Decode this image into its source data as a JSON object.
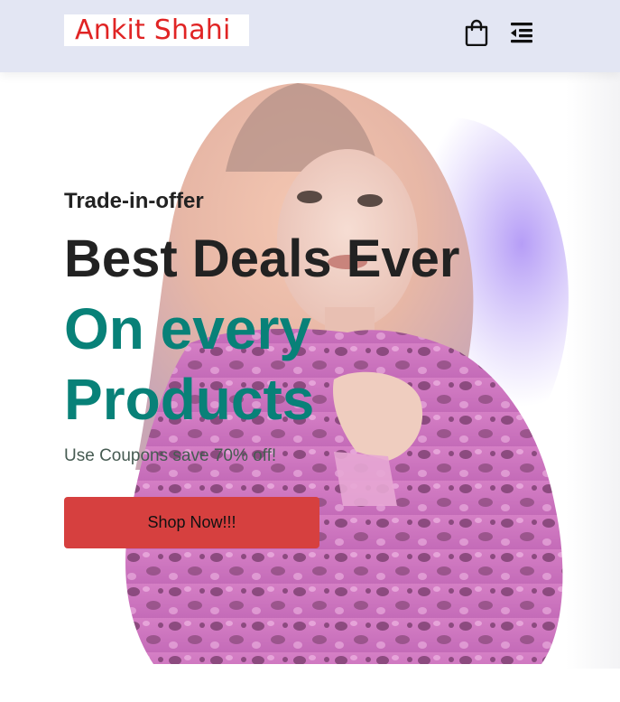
{
  "header": {
    "logo_text": "Ankit Shahi",
    "cart_icon": "shopping-bag-icon",
    "menu_icon": "menu-collapse-icon"
  },
  "hero": {
    "kicker": "Trade-in-offer",
    "headline": "Best Deals Ever",
    "accent_line_1": "On every",
    "accent_line_2": "Products",
    "subtext": "Use Coupons save 70% off!",
    "cta_label": "Shop Now!!!",
    "image": "woman-in-pink-leopard-jacket"
  },
  "colors": {
    "header_bg": "#e3e6f3",
    "accent": "#088178",
    "logo": "#e02424",
    "cta_bg": "#d6403f",
    "text_dark": "#222222"
  }
}
